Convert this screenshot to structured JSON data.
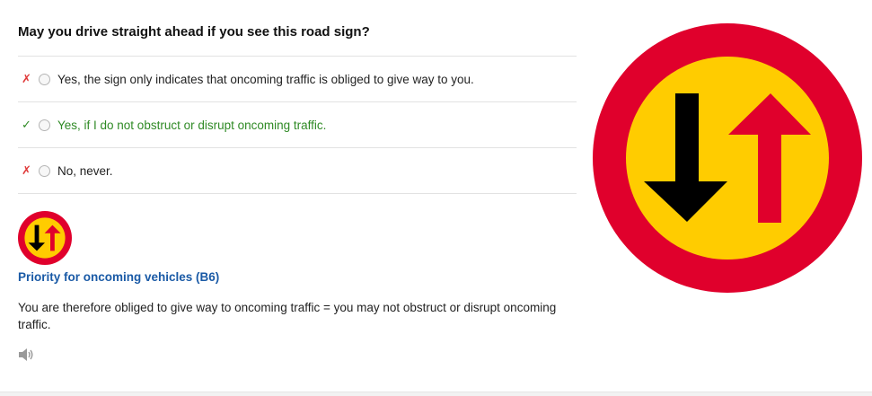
{
  "question": "May you drive straight ahead if you see this road sign?",
  "answers": [
    {
      "status": "wrong",
      "mark": "✗",
      "text": "Yes, the sign only indicates that oncoming traffic is obliged to give way to you."
    },
    {
      "status": "correct",
      "mark": "✓",
      "text": "Yes, if I do not obstruct or disrupt oncoming traffic."
    },
    {
      "status": "wrong",
      "mark": "✗",
      "text": "No, never."
    }
  ],
  "explanation": {
    "sign_title": "Priority for oncoming vehicles (B6)",
    "text": "You are therefore obliged to give way to oncoming traffic = you may not obstruct or disrupt oncoming traffic.",
    "audio_icon": "speaker-icon"
  },
  "colors": {
    "sign_red": "#e0002c",
    "sign_yellow": "#ffcc00",
    "arrow_black": "#000000",
    "correct_green": "#2f8a25",
    "wrong_red": "#e03a3a",
    "link_blue": "#1a5aa6"
  }
}
